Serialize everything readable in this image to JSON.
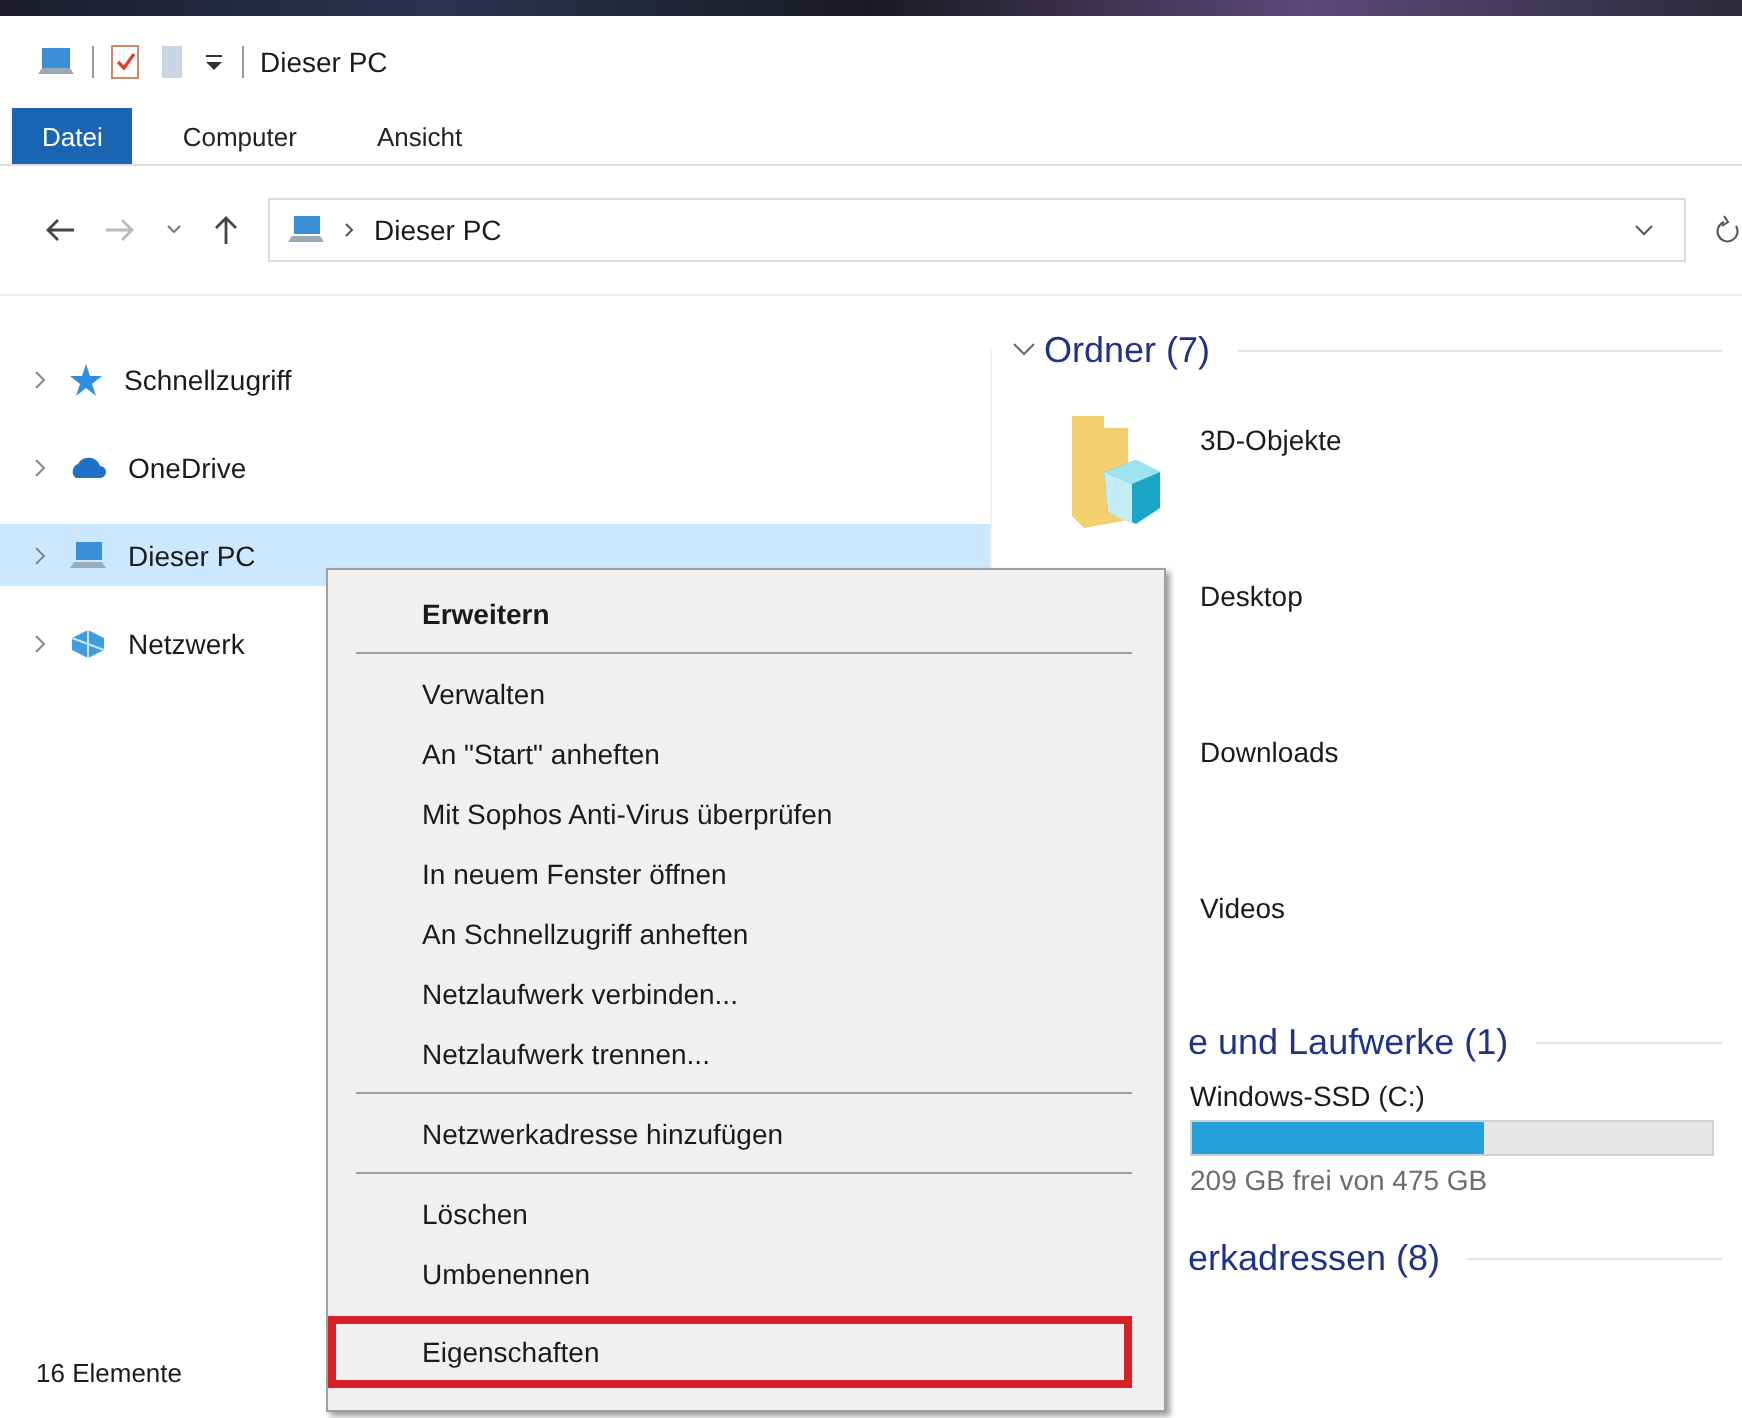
{
  "title_bar": {
    "title": "Dieser PC"
  },
  "ribbon_tabs": [
    {
      "label": "Datei",
      "selected": true
    },
    {
      "label": "Computer",
      "selected": false
    },
    {
      "label": "Ansicht",
      "selected": false
    }
  ],
  "address_bar": {
    "path": "Dieser PC"
  },
  "navigation": [
    {
      "label": "Schnellzugriff",
      "kind": "star",
      "selected": false
    },
    {
      "label": "OneDrive",
      "kind": "cloud",
      "selected": false
    },
    {
      "label": "Dieser PC",
      "kind": "pc",
      "selected": true
    },
    {
      "label": "Netzwerk",
      "kind": "network",
      "selected": false
    }
  ],
  "sections": [
    {
      "title": "Ordner (7)",
      "items": [
        {
          "name": "3D-Objekte",
          "kind": "folder-3d"
        },
        {
          "name": "Desktop",
          "kind": "label"
        },
        {
          "name": "Downloads",
          "kind": "label"
        },
        {
          "name": "Videos",
          "kind": "label"
        }
      ]
    },
    {
      "title": "e und Laufwerke (1)",
      "drives": [
        {
          "name": "Windows-SSD (C:)",
          "level": 0.56,
          "free": "209 GB frei von 475 GB"
        }
      ]
    },
    {
      "title": "erkadressen (8)"
    }
  ],
  "status_bar": {
    "count": "16 Elemente"
  },
  "context_menu": [
    {
      "kind": "item",
      "label": "Erweitern",
      "default": true,
      "highlighted": false
    },
    {
      "kind": "separator"
    },
    {
      "kind": "item",
      "label": "Verwalten",
      "default": false,
      "highlighted": false
    },
    {
      "kind": "item",
      "label": "An \"Start\" anheften",
      "default": false,
      "highlighted": false
    },
    {
      "kind": "item",
      "label": "Mit Sophos Anti-Virus überprüfen",
      "default": false,
      "highlighted": false
    },
    {
      "kind": "item",
      "label": "In neuem Fenster öffnen",
      "default": false,
      "highlighted": false
    },
    {
      "kind": "item",
      "label": "An Schnellzugriff anheften",
      "default": false,
      "highlighted": false
    },
    {
      "kind": "item",
      "label": "Netzlaufwerk verbinden...",
      "default": false,
      "highlighted": false
    },
    {
      "kind": "item",
      "label": "Netzlaufwerk trennen...",
      "default": false,
      "highlighted": false
    },
    {
      "kind": "separator"
    },
    {
      "kind": "item",
      "label": "Netzwerkadresse hinzufügen",
      "default": false,
      "highlighted": false
    },
    {
      "kind": "separator"
    },
    {
      "kind": "item",
      "label": "Löschen",
      "default": false,
      "highlighted": false
    },
    {
      "kind": "item",
      "label": "Umbenennen",
      "default": false,
      "highlighted": false
    },
    {
      "kind": "item",
      "label": "Eigenschaften",
      "default": false,
      "highlighted": true
    }
  ]
}
